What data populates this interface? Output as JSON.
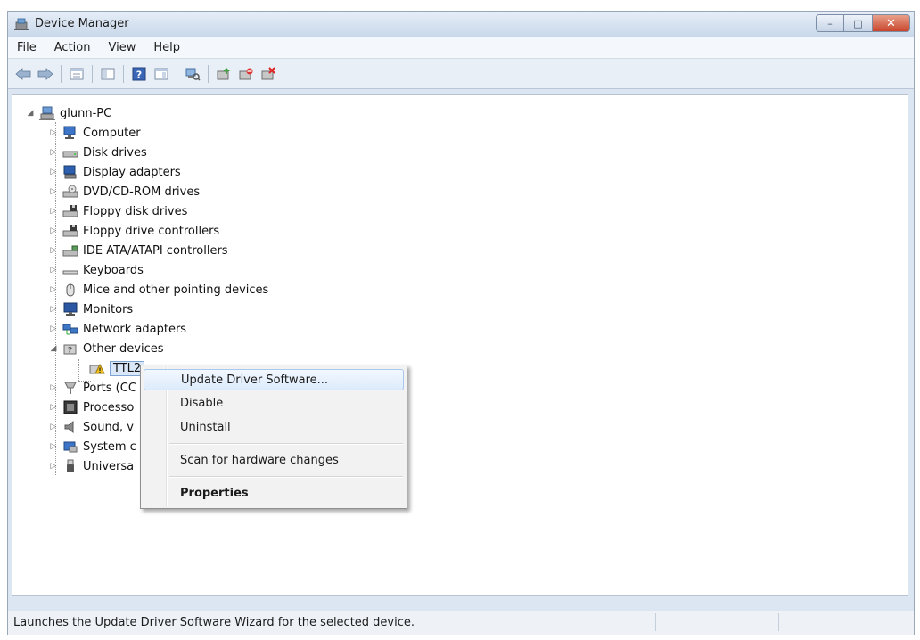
{
  "window": {
    "title": "Device Manager",
    "controls": {
      "minimize": "–",
      "maximize": "□",
      "close": "✕"
    }
  },
  "menu": [
    "File",
    "Action",
    "View",
    "Help"
  ],
  "toolbar": {
    "buttons": [
      "back-icon",
      "forward-icon",
      "properties-icon",
      "show-hide-console-tree-icon",
      "help-icon",
      "show-hide-action-pane-icon",
      "scan-hardware-icon",
      "update-driver-icon",
      "disable-device-icon",
      "uninstall-device-icon"
    ]
  },
  "tree": {
    "root": "glunn-PC",
    "categories": [
      {
        "label": "Computer",
        "icon": "computer-icon",
        "expanded": false
      },
      {
        "label": "Disk drives",
        "icon": "disk-drive-icon",
        "expanded": false
      },
      {
        "label": "Display adapters",
        "icon": "display-adapter-icon",
        "expanded": false
      },
      {
        "label": "DVD/CD-ROM drives",
        "icon": "dvd-drive-icon",
        "expanded": false
      },
      {
        "label": "Floppy disk drives",
        "icon": "floppy-disk-icon",
        "expanded": false
      },
      {
        "label": "Floppy drive controllers",
        "icon": "floppy-controller-icon",
        "expanded": false
      },
      {
        "label": "IDE ATA/ATAPI controllers",
        "icon": "ide-controller-icon",
        "expanded": false
      },
      {
        "label": "Keyboards",
        "icon": "keyboard-icon",
        "expanded": false
      },
      {
        "label": "Mice and other pointing devices",
        "icon": "mouse-icon",
        "expanded": false
      },
      {
        "label": "Monitors",
        "icon": "monitor-icon",
        "expanded": false
      },
      {
        "label": "Network adapters",
        "icon": "network-adapter-icon",
        "expanded": false
      },
      {
        "label": "Other devices",
        "icon": "other-devices-icon",
        "expanded": true
      },
      {
        "label": "Ports (CC",
        "icon": "port-icon",
        "expanded": false
      },
      {
        "label": "Processo",
        "icon": "processor-icon",
        "expanded": false
      },
      {
        "label": "Sound, v",
        "icon": "sound-icon",
        "expanded": false
      },
      {
        "label": "System c",
        "icon": "system-device-icon",
        "expanded": false
      },
      {
        "label": "Universa",
        "icon": "usb-icon",
        "expanded": false
      }
    ],
    "child_device": {
      "label": "TTL2",
      "icon": "warning-device-icon"
    }
  },
  "context_menu": {
    "items": [
      {
        "label": "Update Driver Software...",
        "highlighted": true,
        "bold": false
      },
      {
        "label": "Disable",
        "highlighted": false,
        "bold": false
      },
      {
        "label": "Uninstall",
        "highlighted": false,
        "bold": false
      },
      {
        "label": "Scan for hardware changes",
        "highlighted": false,
        "bold": false
      },
      {
        "label": "Properties",
        "highlighted": false,
        "bold": true
      }
    ]
  },
  "status": {
    "text": "Launches the Update Driver Software Wizard for the selected device."
  },
  "colors": {
    "accent": "#3a78c9",
    "warning": "#e8b01c"
  }
}
